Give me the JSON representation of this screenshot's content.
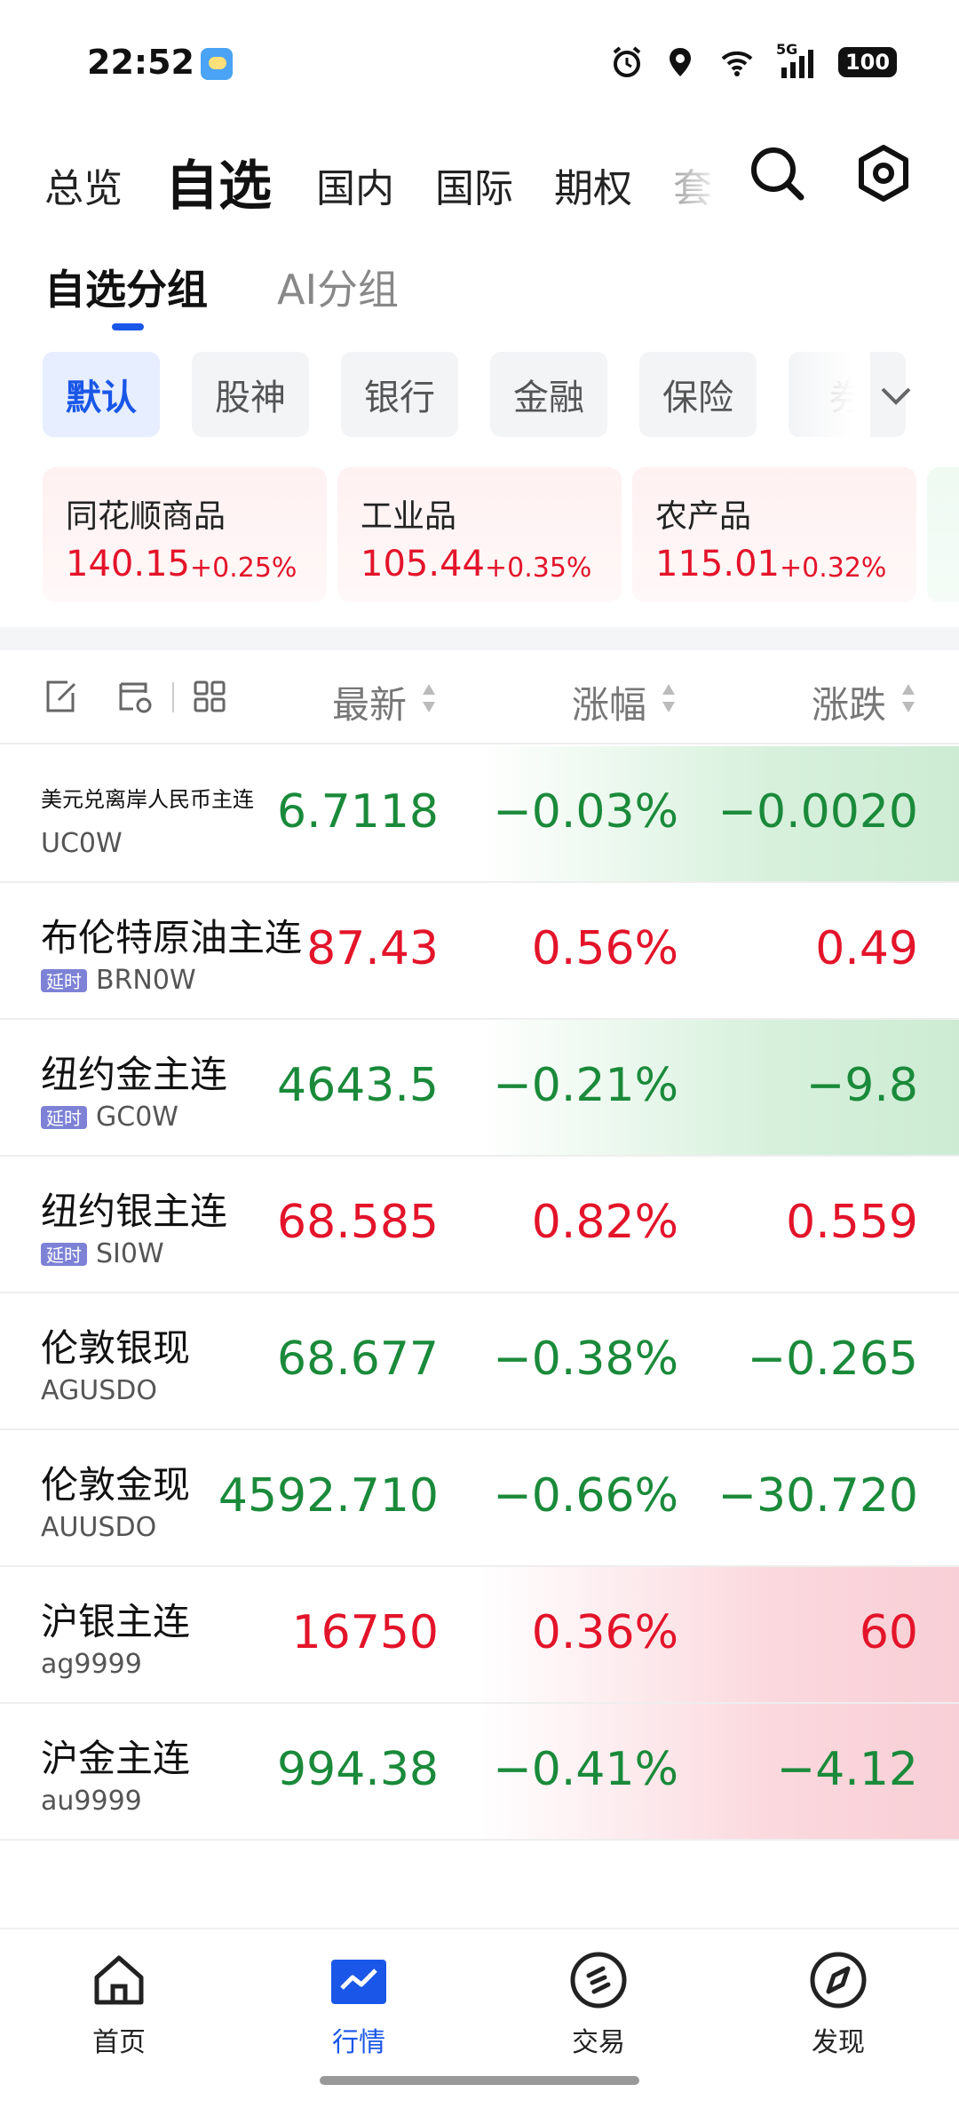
{
  "status_bar": {
    "time": "22:52",
    "battery": "100",
    "network_label": "5G"
  },
  "top_nav": {
    "tabs": [
      {
        "label": "总览"
      },
      {
        "label": "自选"
      },
      {
        "label": "国内"
      },
      {
        "label": "国际"
      },
      {
        "label": "期权"
      },
      {
        "label": "套"
      }
    ],
    "active": "自选"
  },
  "group_tabs": [
    {
      "label": "自选分组"
    },
    {
      "label": "AI分组"
    }
  ],
  "chips": [
    {
      "label": "默认"
    },
    {
      "label": "股神"
    },
    {
      "label": "银行"
    },
    {
      "label": "金融"
    },
    {
      "label": "保险"
    },
    {
      "label": "券"
    }
  ],
  "index_cards": [
    {
      "name": "同花顺商品",
      "price": "140.15",
      "pct": "+0.25%"
    },
    {
      "name": "工业品",
      "price": "105.44",
      "pct": "+0.35%"
    },
    {
      "name": "农产品",
      "price": "115.01",
      "pct": "+0.32%"
    }
  ],
  "list_header": {
    "col_latest": "最新",
    "col_pct": "涨幅",
    "col_change": "涨跌"
  },
  "rows": [
    {
      "name": "美元兑离岸人民币主连",
      "code": "UC0W",
      "delayed": false,
      "latest": "6.7118",
      "pct": "−0.03%",
      "change": "−0.0020",
      "direction": "down",
      "latest_direction": "down"
    },
    {
      "name": "布伦特原油主连",
      "code": "BRN0W",
      "delayed": true,
      "delay_label": "延时",
      "latest": "87.43",
      "pct": "0.56%",
      "change": "0.49",
      "direction": "up",
      "latest_direction": "up"
    },
    {
      "name": "纽约金主连",
      "code": "GC0W",
      "delayed": true,
      "delay_label": "延时",
      "latest": "4643.5",
      "pct": "−0.21%",
      "change": "−9.8",
      "direction": "down",
      "latest_direction": "down"
    },
    {
      "name": "纽约银主连",
      "code": "SI0W",
      "delayed": true,
      "delay_label": "延时",
      "latest": "68.585",
      "pct": "0.82%",
      "change": "0.559",
      "direction": "up",
      "latest_direction": "up"
    },
    {
      "name": "伦敦银现",
      "code": "AGUSDO",
      "delayed": false,
      "latest": "68.677",
      "pct": "−0.38%",
      "change": "−0.265",
      "direction": "down",
      "latest_direction": "down"
    },
    {
      "name": "伦敦金现",
      "code": "AUUSDO",
      "delayed": false,
      "latest": "4592.710",
      "pct": "−0.66%",
      "change": "−30.720",
      "direction": "down",
      "latest_direction": "down"
    },
    {
      "name": "沪银主连",
      "code": "ag9999",
      "delayed": false,
      "latest": "16750",
      "pct": "0.36%",
      "change": "60",
      "direction": "up",
      "latest_direction": "up"
    },
    {
      "name": "沪金主连",
      "code": "au9999",
      "delayed": false,
      "latest": "994.38",
      "pct": "−0.41%",
      "change": "−4.12",
      "direction": "down",
      "latest_direction": "down"
    }
  ],
  "bottom_nav": [
    {
      "label": "首页",
      "icon": "home-icon"
    },
    {
      "label": "行情",
      "icon": "market-chart-icon"
    },
    {
      "label": "交易",
      "icon": "trade-icon"
    },
    {
      "label": "发现",
      "icon": "compass-icon"
    }
  ],
  "colors": {
    "up": "#e3142a",
    "down": "#1a8a3a",
    "accent": "#1a57e8",
    "delay_badge": "#7d82d6"
  }
}
